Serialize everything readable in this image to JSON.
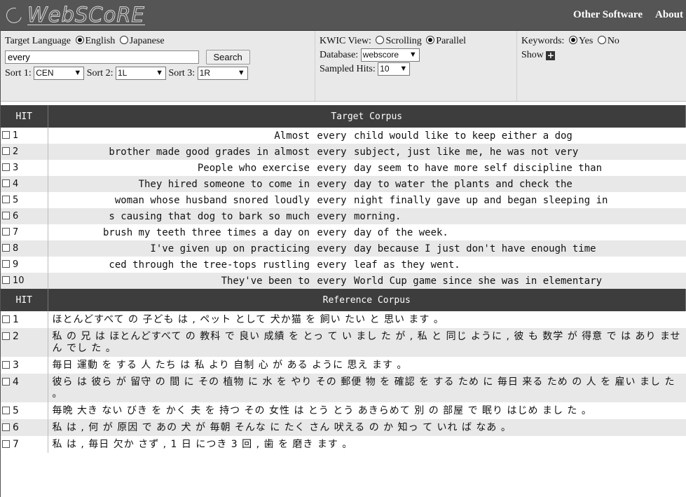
{
  "header": {
    "logo_text": "WebSCoRE",
    "nav": [
      "Other Software",
      "About"
    ]
  },
  "controls": {
    "target_language_label": "Target Language",
    "lang_options": [
      "English",
      "Japanese"
    ],
    "lang_selected": "English",
    "search_value": "every",
    "search_button": "Search",
    "sort1_label": "Sort 1:",
    "sort1_value": "CEN",
    "sort2_label": "Sort 2:",
    "sort2_value": "1L",
    "sort3_label": "Sort 3:",
    "sort3_value": "1R",
    "kwic_label": "KWIC View:",
    "kwic_options": [
      "Scrolling",
      "Parallel"
    ],
    "kwic_selected": "Parallel",
    "database_label": "Database:",
    "database_value": "webscore",
    "sampled_label": "Sampled Hits:",
    "sampled_value": "10",
    "keywords_label": "Keywords:",
    "keywords_options": [
      "Yes",
      "No"
    ],
    "keywords_selected": "Yes",
    "show_label": "Show"
  },
  "target": {
    "hit_header": "HIT",
    "title": "Target Corpus",
    "rows": [
      {
        "n": "1",
        "left": "Almost",
        "key": "every",
        "right": "child would like to keep either a dog"
      },
      {
        "n": "2",
        "left": "brother made good grades in almost",
        "key": "every",
        "right": "subject, just like me, he was not very"
      },
      {
        "n": "3",
        "left": "People who exercise",
        "key": "every",
        "right": "day seem to have more self discipline than"
      },
      {
        "n": "4",
        "left": "They hired someone to come in",
        "key": "every",
        "right": "day to water the plants and check the"
      },
      {
        "n": "5",
        "left": "woman whose husband snored loudly",
        "key": "every",
        "right": "night finally gave up and began sleeping in"
      },
      {
        "n": "6",
        "left": "s causing that dog to bark so much",
        "key": "every",
        "right": "morning."
      },
      {
        "n": "7",
        "left": "brush my teeth three times a day on",
        "key": "every",
        "right": "day of the week."
      },
      {
        "n": "8",
        "left": "I've given up on practicing",
        "key": "every",
        "right": "day because I just don't have enough time"
      },
      {
        "n": "9",
        "left": "ced through the tree-tops rustling",
        "key": "every",
        "right": "leaf as they went."
      },
      {
        "n": "10",
        "left": "They've been to",
        "key": "every",
        "right": "World Cup game since she was in elementary"
      }
    ]
  },
  "reference": {
    "hit_header": "HIT",
    "title": "Reference Corpus",
    "rows": [
      {
        "n": "1",
        "text": "ほとんどすべて の 子ども は , ペット として 犬か猫 を 飼い たい と 思い ます 。"
      },
      {
        "n": "2",
        "text": "私 の 兄 は ほとんどすべて の 教科 で 良い 成績 を とっ て い まし た が , 私 と 同じ ように , 彼 も 数学 が 得意 で は あり ませ ん でし た 。"
      },
      {
        "n": "3",
        "text": "毎日 運動 を する 人 たち は 私 より 自制 心 が ある ように 思え ます 。"
      },
      {
        "n": "4",
        "text": "彼ら は 彼ら が 留守 の 間 に その 植物 に 水 を やり その 郵便 物 を 確認 を する ため に 毎日 来る ため の 人 を 雇い まし た 。"
      },
      {
        "n": "5",
        "text": "毎晩 大き ない びき を かく 夫 を 持つ その 女性 は とう とう あきらめて 別 の 部屋 で 眠り はじめ まし た 。"
      },
      {
        "n": "6",
        "text": "私 は , 何 が 原因 で あの 犬 が 毎朝 そんな に たく さん 吠える の か 知っ て いれ ば なあ 。"
      },
      {
        "n": "7",
        "text": "私 は , 毎日 欠か さず , 1 日 につき 3 回 , 歯 を 磨き ます 。"
      }
    ]
  }
}
